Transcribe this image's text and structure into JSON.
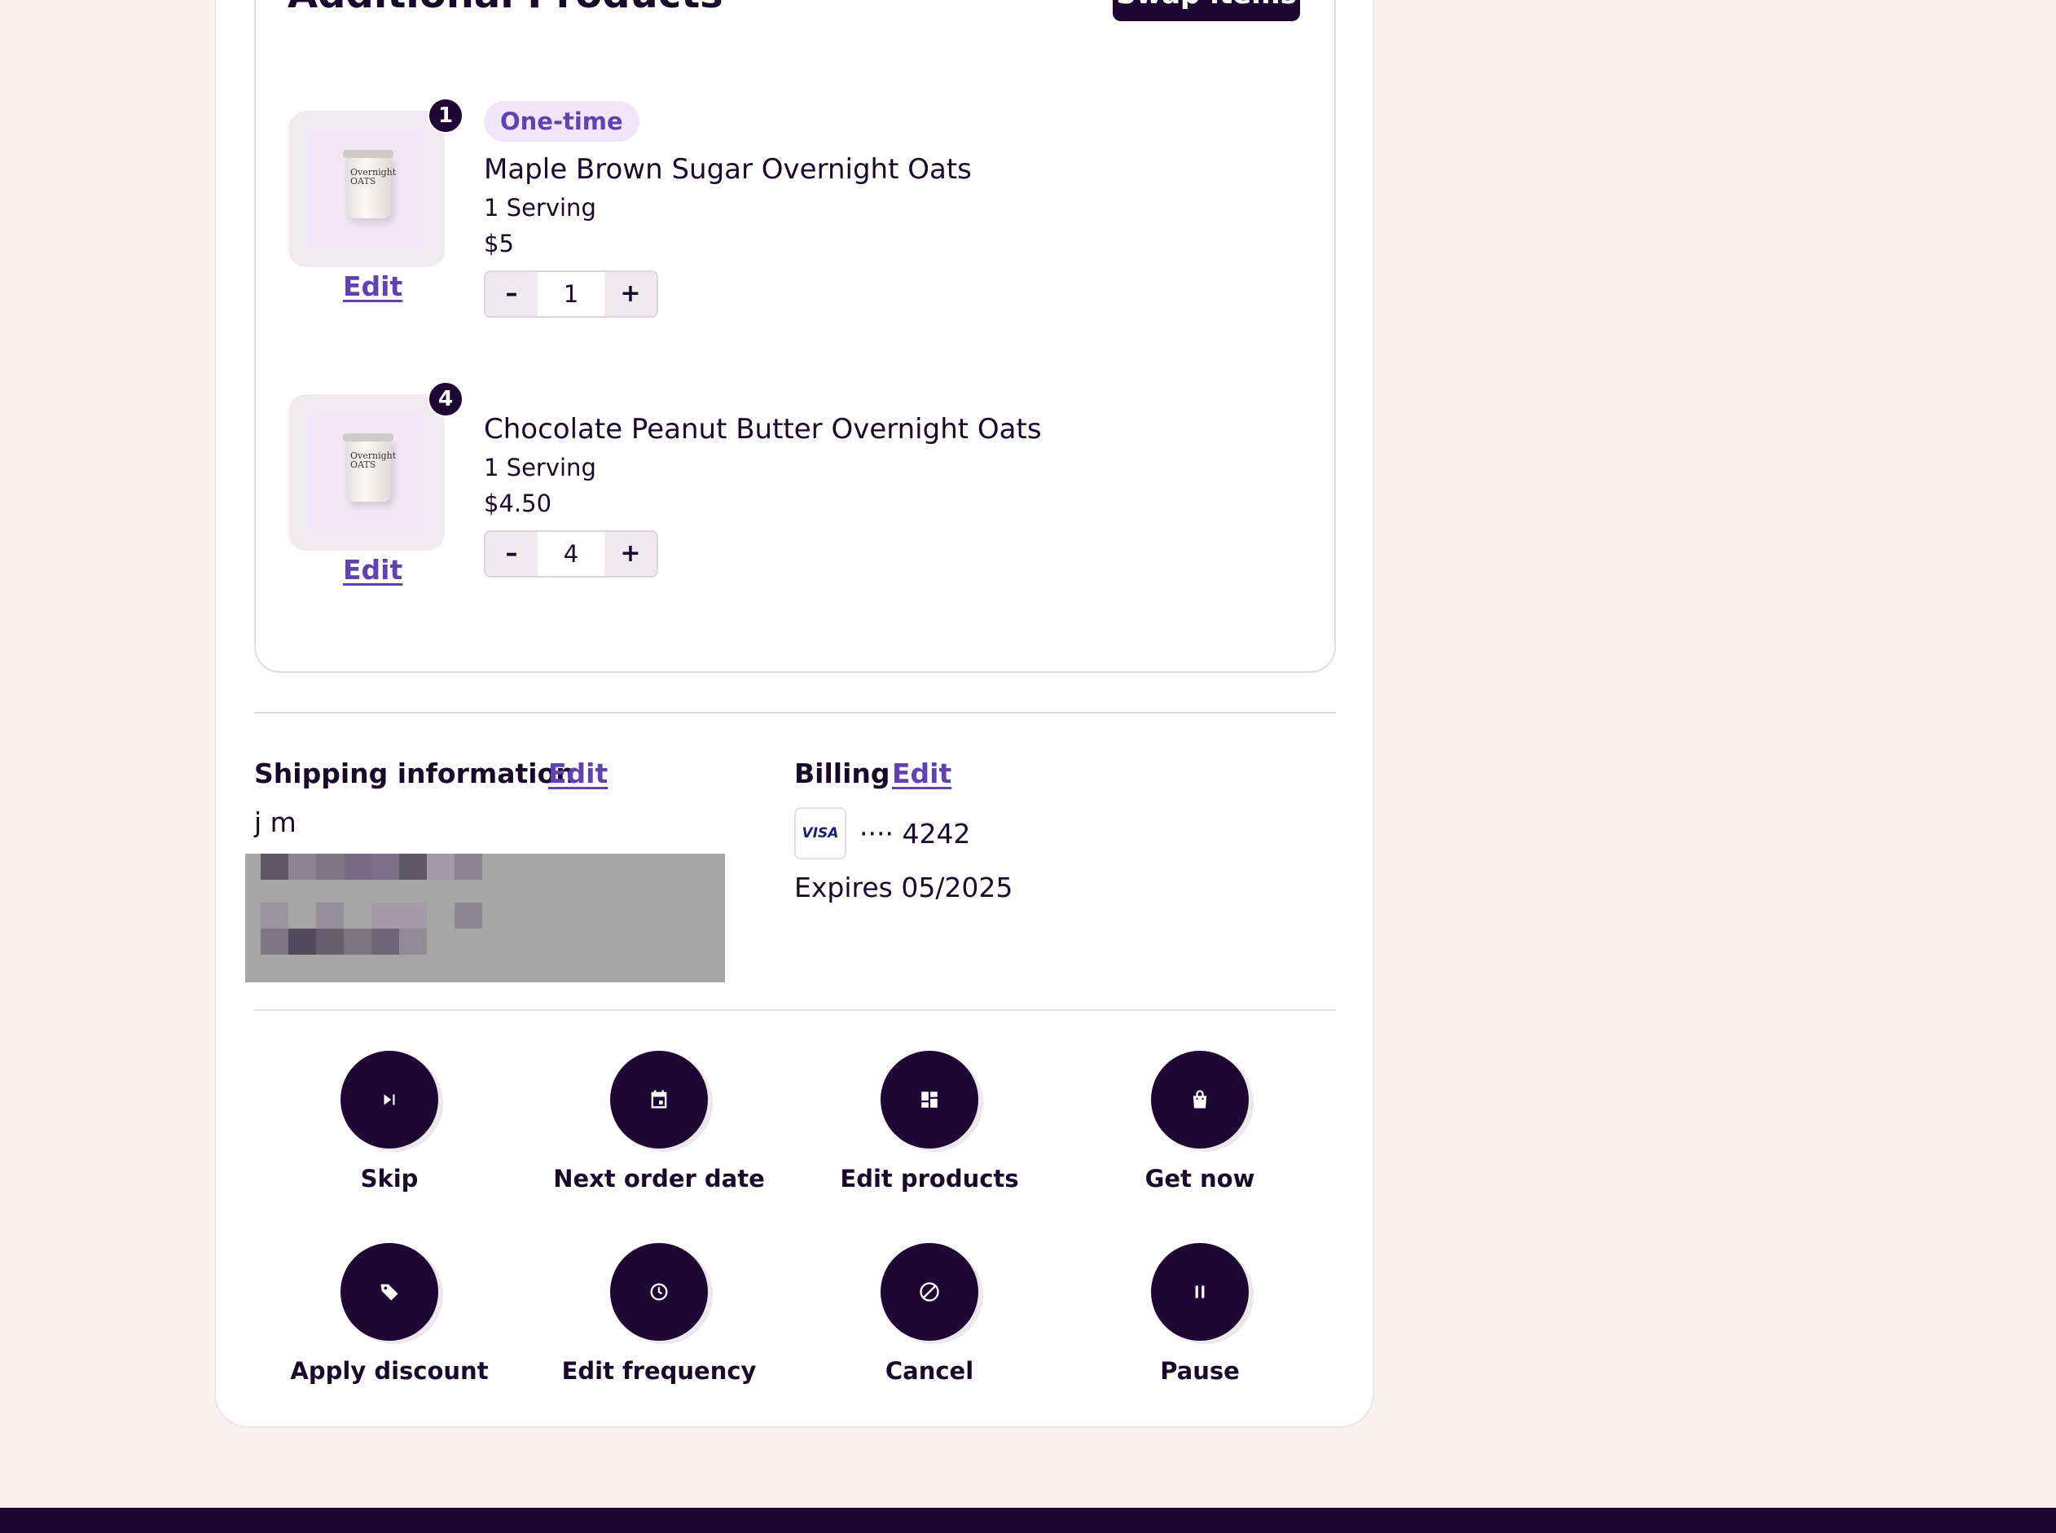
{
  "products_section": {
    "heading": "Additional Products",
    "top_button": "Swap items"
  },
  "products": [
    {
      "badge": "1",
      "tag": "One-time",
      "name": "Maple Brown Sugar Overnight Oats",
      "size": "1 Serving",
      "price": "$5",
      "quantity": "1",
      "edit_label": "Edit",
      "image_text": "Overnight OATS"
    },
    {
      "badge": "4",
      "tag": "",
      "name": "Chocolate Peanut Butter Overnight Oats",
      "size": "1 Serving",
      "price": "$4.50",
      "quantity": "4",
      "edit_label": "Edit",
      "image_text": "Overnight OATS"
    }
  ],
  "stepper": {
    "minus": "–",
    "plus": "+"
  },
  "shipping": {
    "title": "Shipping information",
    "edit_label": "Edit",
    "name": "j m"
  },
  "billing": {
    "title": "Billing",
    "edit_label": "Edit",
    "card_brand": "VISA",
    "card_masked": "···· 4242",
    "expires": "Expires 05/2025"
  },
  "actions": [
    {
      "label": "Skip",
      "icon": "skip-next-icon"
    },
    {
      "label": "Next order date",
      "icon": "calendar-icon"
    },
    {
      "label": "Edit products",
      "icon": "dashboard-icon"
    },
    {
      "label": "Get now",
      "icon": "shopping-bag-icon"
    },
    {
      "label": "Apply discount",
      "icon": "tag-icon"
    },
    {
      "label": "Edit frequency",
      "icon": "clock-icon"
    },
    {
      "label": "Cancel",
      "icon": "cancel-icon"
    },
    {
      "label": "Pause",
      "icon": "pause-icon"
    }
  ],
  "colors": {
    "background": "#f9f3ee",
    "primary_dark": "#1e0733",
    "accent_purple": "#6142b0",
    "tag_bg": "#efe7f7"
  }
}
